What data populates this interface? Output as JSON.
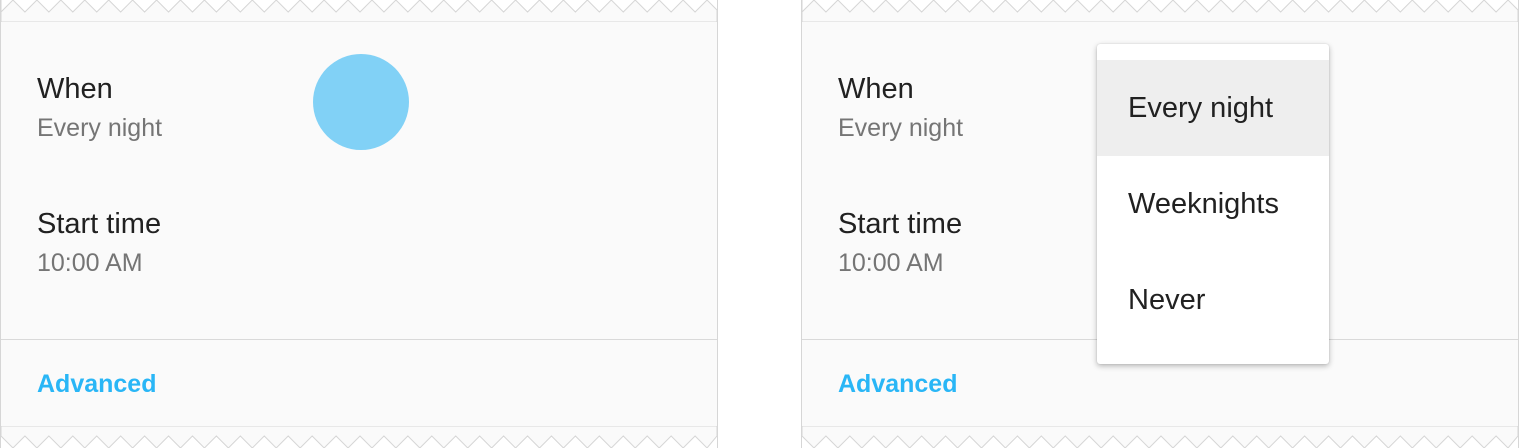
{
  "left_panel": {
    "when": {
      "title": "When",
      "value": "Every night"
    },
    "start_time": {
      "title": "Start time",
      "value": "10:00 AM"
    },
    "advanced_label": "Advanced"
  },
  "right_panel": {
    "when": {
      "title": "When",
      "value": "Every night"
    },
    "start_time": {
      "title": "Start time",
      "value": "10:00 AM"
    },
    "advanced_label": "Advanced",
    "menu": {
      "selected": "Every night",
      "items": [
        {
          "label": "Every night"
        },
        {
          "label": "Weeknights"
        },
        {
          "label": "Never"
        }
      ]
    }
  },
  "colors": {
    "accent": "#29b6f6",
    "touch_ripple": "#81d1f6",
    "primary_text": "#212121",
    "secondary_text": "#757575",
    "panel_bg": "#fafafa",
    "selected_item_bg": "#eeeeee"
  }
}
